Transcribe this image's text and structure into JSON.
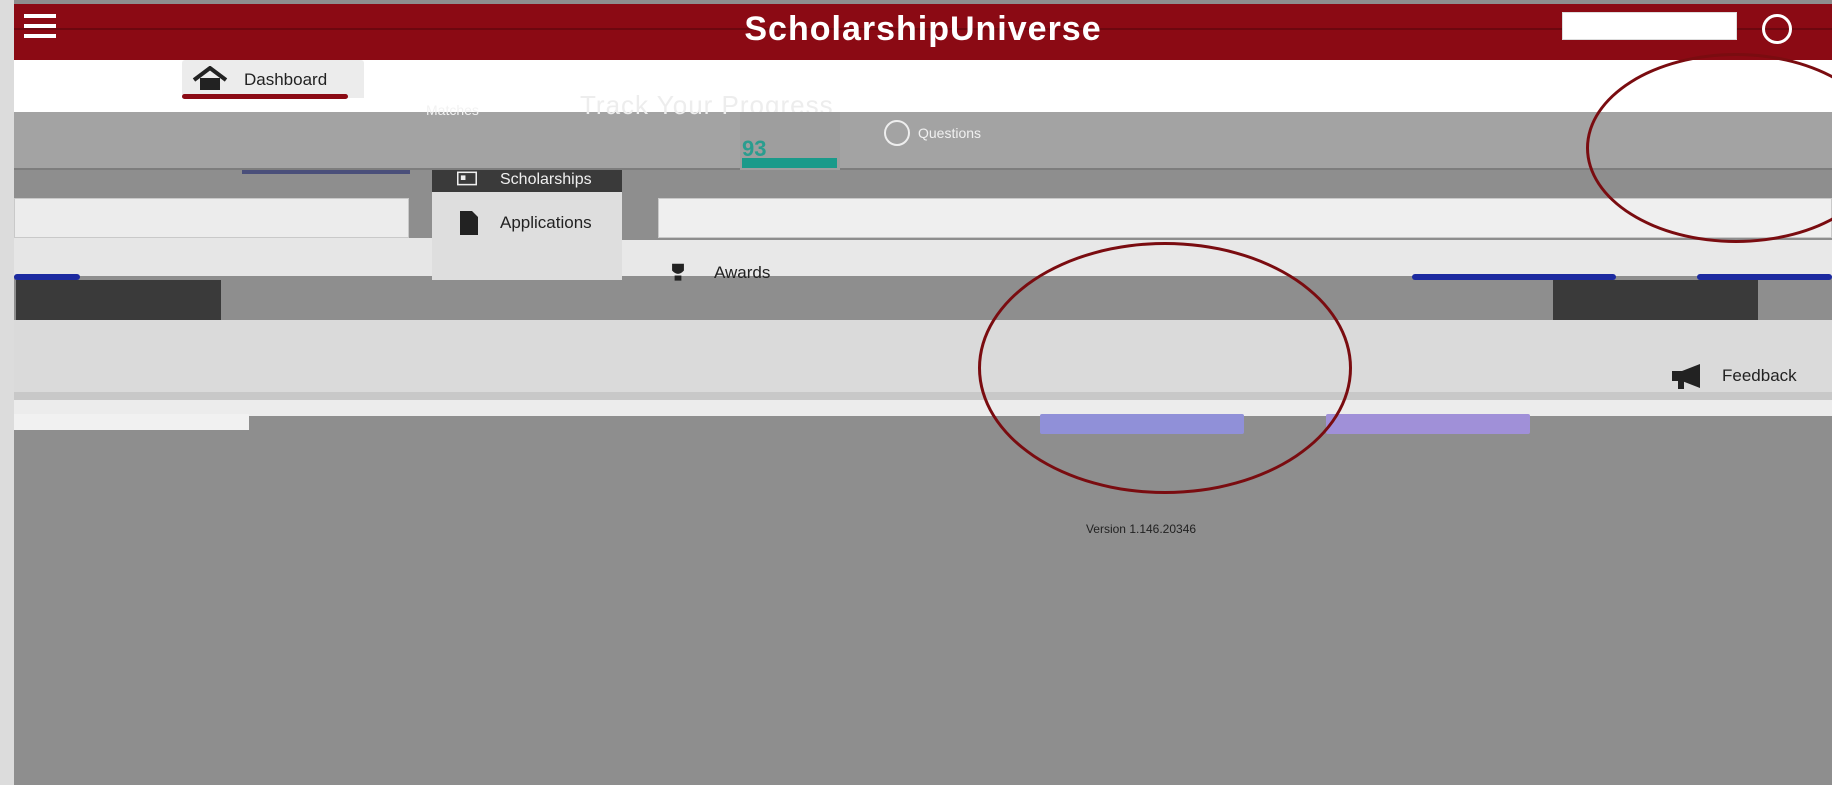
{
  "brand": {
    "title": "ScholarshipUniverse",
    "colors": {
      "primary": "#8b0a14",
      "teal": "#1a9a8a",
      "circle": "#7a0c10"
    }
  },
  "header": {
    "menu_icon": "hamburger-icon",
    "user_icon": "user-circle-icon",
    "search_placeholder": ""
  },
  "nav": {
    "tabs": [
      {
        "label": "Dashboard",
        "icon": "home-icon",
        "active": true
      }
    ]
  },
  "stats": {
    "matches_label": "Matches",
    "progress_title": "Track Your Progress",
    "matches_value": "93",
    "questions_label": "Questions"
  },
  "sidemenu": {
    "items": [
      {
        "label": "Scholarships",
        "icon": "scholarship-icon",
        "selected": true
      },
      {
        "label": "Applications",
        "icon": "document-icon"
      },
      {
        "label": "Awards",
        "icon": "trophy-icon"
      }
    ]
  },
  "feedback": {
    "label": "Feedback",
    "icon": "megaphone-icon"
  },
  "footer": {
    "version": "Version 1.146.20346"
  }
}
